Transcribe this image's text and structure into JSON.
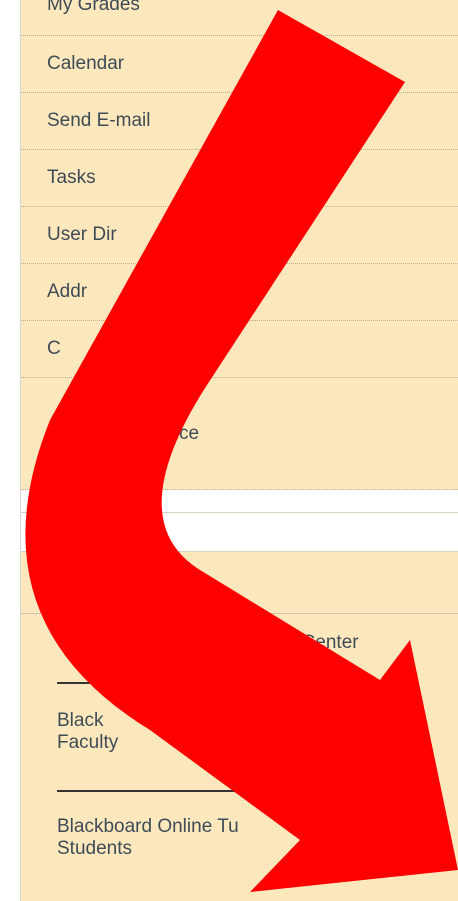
{
  "menu": {
    "items": [
      {
        "label": "My Grades"
      },
      {
        "label": "Calendar"
      },
      {
        "label": "Send E-mail"
      },
      {
        "label": "Tasks"
      },
      {
        "label": "User Dir"
      },
      {
        "label": "Addr"
      },
      {
        "label": "C                        Hub"
      },
      {
        "label": "                  mance"
      }
    ]
  },
  "tools": {
    "center_label": "t Center",
    "links": [
      {
        "line1": "Black",
        "line2": "Faculty"
      },
      {
        "line1": "Blackboard Online Tu",
        "line2": "Students"
      }
    ]
  },
  "annotation": {
    "arrow_color": "#ff0000"
  }
}
